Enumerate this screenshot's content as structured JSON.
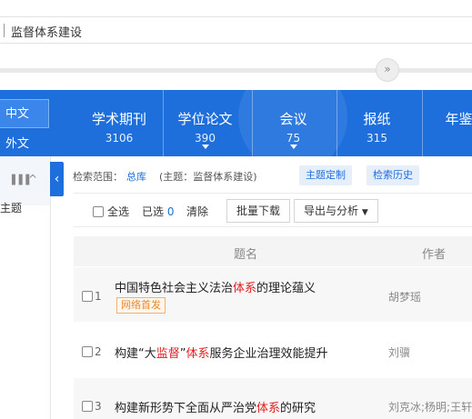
{
  "search": {
    "query": "监督体系建设"
  },
  "collapse_icon": "double-chevron-down-icon",
  "languages": {
    "chinese": "中文",
    "foreign": "外文"
  },
  "db_tabs": [
    {
      "name": "学术期刊",
      "count": "3106"
    },
    {
      "name": "学位论文",
      "count": "390"
    },
    {
      "name": "会议",
      "count": "75"
    },
    {
      "name": "报纸",
      "count": "315"
    },
    {
      "name": "年鉴",
      "count": ""
    }
  ],
  "left_panel": {
    "chart_icon": "bar-chart-icon",
    "collapse_icon": "chevron-up-icon",
    "topic_label": "主题"
  },
  "side_toggle_icon": "chevron-left-icon",
  "scope": {
    "label": "检索范围：",
    "library": "总库",
    "topic_query": "(主题：监督体系建设)",
    "custom_button": "主题定制",
    "history_button": "检索历史"
  },
  "toolbar": {
    "select_all": "全选",
    "selected_label": "已选",
    "selected_count": "0",
    "clear": "清除",
    "batch_download": "批量下载",
    "export_analysis": "导出与分析"
  },
  "table": {
    "headers": {
      "title": "题名",
      "author": "作者"
    },
    "rows": [
      {
        "index": "1",
        "title_parts": [
          "中国特色社会主义法治",
          "体系",
          "的理论蕴义"
        ],
        "badge": "网络首发",
        "author": "胡梦瑶"
      },
      {
        "index": "2",
        "title_parts": [
          "构建“大",
          "监督",
          "”",
          "体系",
          "服务企业治理效能提升"
        ],
        "badge": "",
        "author": "刘骥"
      },
      {
        "index": "3",
        "title_parts": [
          "构建新形势下全面从严治党",
          "体系",
          "的研究"
        ],
        "badge": "",
        "author": "刘克冰;杨明;王轩"
      }
    ]
  },
  "colors": {
    "primary": "#1e6fdc",
    "highlight": "#e02020",
    "badge": "#e88a2c"
  }
}
